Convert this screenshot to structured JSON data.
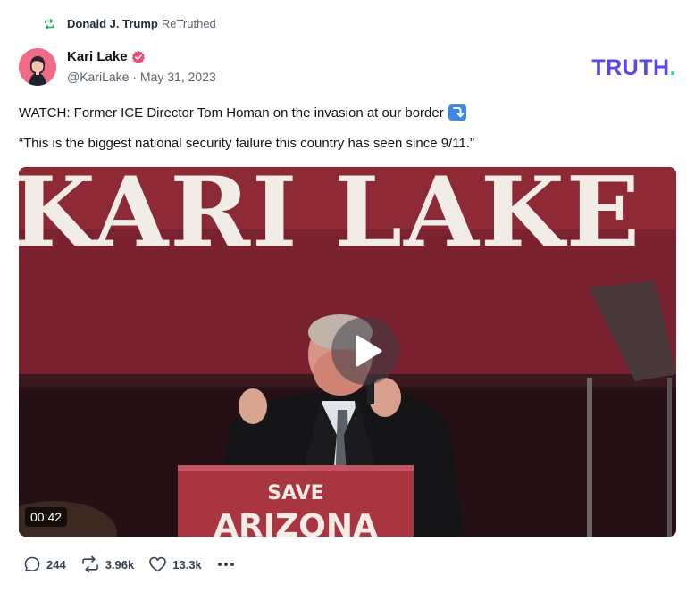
{
  "retruth": {
    "user": "Donald J. Trump",
    "action": "ReTruthed",
    "icon": "retruth-icon"
  },
  "post": {
    "author_name": "Kari Lake",
    "author_handle": "@KariLake",
    "separator": "·",
    "date": "May 31, 2023",
    "verified_icon": "verified-badge-icon",
    "text_line1": "WATCH: Former ICE Director Tom Homan on the invasion at our border",
    "text_line1_emoji": "right-arrow-curving-down-icon",
    "text_line2": "“This is the biggest national security failure this country has seen since 9/11.”"
  },
  "brand": {
    "logo_text": "TRUTH",
    "logo_dot": ".",
    "logo_color": "#5448ee",
    "dot_color": "#1ad6c9"
  },
  "video": {
    "duration": "00:42",
    "banner_text": "KARI LAKE",
    "podium_line1": "SAVE",
    "podium_line2": "ARIZONA",
    "play_icon": "play-icon"
  },
  "actions": {
    "replies": "244",
    "retruths": "3.96k",
    "likes": "13.3k",
    "more_icon": "more-icon"
  }
}
